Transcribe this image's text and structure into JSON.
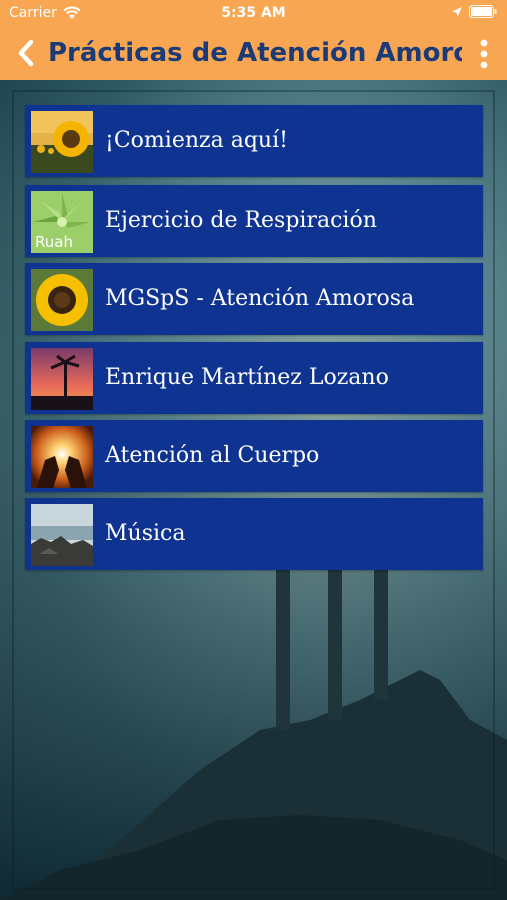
{
  "status_bar": {
    "carrier": "Carrier",
    "time": "5:35 AM"
  },
  "header": {
    "title": "Prácticas de Atención Amorosa",
    "background_color": "#f9a652",
    "title_color": "#1b3a78",
    "back_icon": "chevron-left-icon",
    "more_icon": "vertical-ellipsis-icon"
  },
  "list": {
    "item_color": "#0e3391",
    "items": [
      {
        "label": "¡Comienza aquí!",
        "thumb": "sunflower-field"
      },
      {
        "label": "Ejercicio de Respiración",
        "thumb": "ruah-succulent"
      },
      {
        "label": "MGSpS - Atención Amorosa",
        "thumb": "sunflower"
      },
      {
        "label": "Enrique Martínez Lozano",
        "thumb": "palm-sunset"
      },
      {
        "label": "Atención al Cuerpo",
        "thumb": "hands-sun"
      },
      {
        "label": "Música",
        "thumb": "rocky-shore"
      }
    ],
    "ruah_text": "Ruah"
  }
}
